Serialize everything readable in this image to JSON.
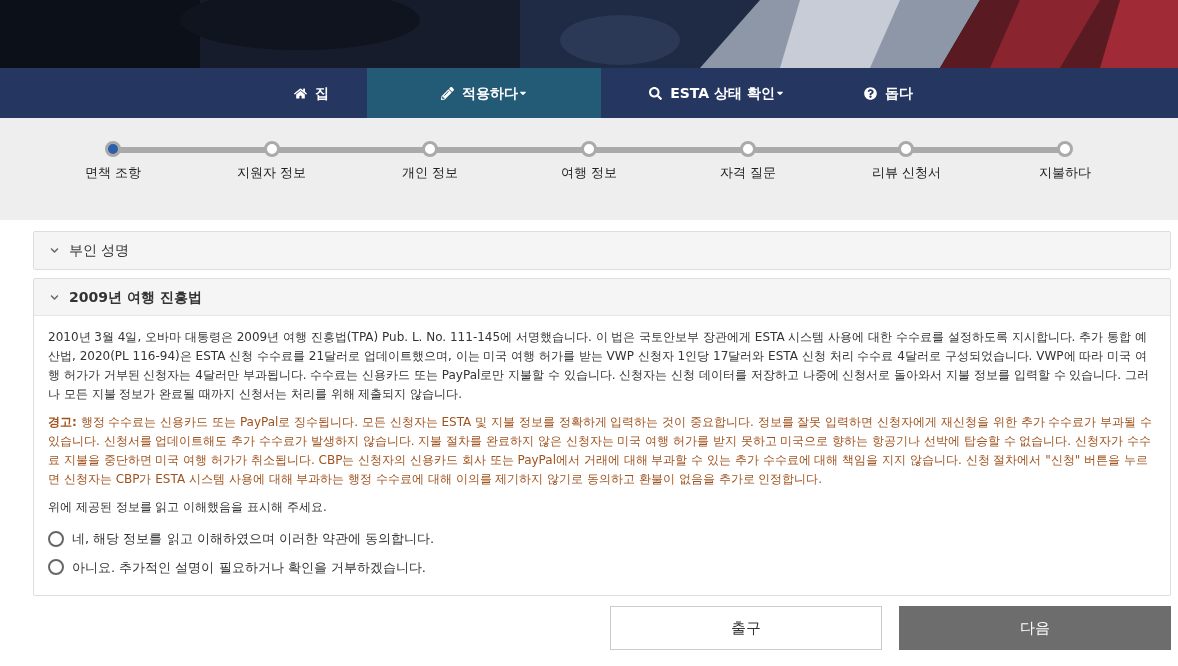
{
  "nav": [
    {
      "label": "집",
      "kind": "home",
      "selected": false,
      "dropdown": false
    },
    {
      "label": "적용하다",
      "kind": "pencil",
      "selected": true,
      "dropdown": true
    },
    {
      "label": "ESTA 상태 확인",
      "kind": "search",
      "selected": false,
      "dropdown": true
    },
    {
      "label": "돕다",
      "kind": "help",
      "selected": false,
      "dropdown": false
    }
  ],
  "steps": [
    {
      "label": "면책 조항",
      "selected": true
    },
    {
      "label": "지원자 정보",
      "selected": false
    },
    {
      "label": "개인 정보",
      "selected": false
    },
    {
      "label": "여행 정보",
      "selected": false
    },
    {
      "label": "자격 질문",
      "selected": false
    },
    {
      "label": "리뷰 신청서",
      "selected": false
    },
    {
      "label": "지불하다",
      "selected": false
    }
  ],
  "sections": [
    {
      "title": "부인 성명",
      "expanded": false
    },
    {
      "title": "2009년 여행 진흥법",
      "expanded": true,
      "paragraphs": [
        {
          "kind": "normal",
          "text": "2010년 3월 4일, 오바마 대통령은 2009년 여행 진흥법(TPA) Pub. L. No. 111-145에 서명했습니다. 이 법은 국토안보부 장관에게 ESTA 시스템 사용에 대한 수수료를 설정하도록 지시합니다. 추가 통합 예산법, 2020(PL 116-94)은 ESTA 신청 수수료를 21달러로 업데이트했으며, 이는 미국 여행 허가를 받는 VWP 신청자 1인당 17달러와 ESTA 신청 처리 수수료 4달러로 구성되었습니다. VWP에 따라 미국 여행 허가가 거부된 신청자는 4달러만 부과됩니다. 수수료는 신용카드 또는 PayPal로만 지불할 수 있습니다. 신청자는 신청 데이터를 저장하고 나중에 신청서로 돌아와서 지불 정보를 입력할 수 있습니다. 그러나 모든 지불 정보가 완료될 때까지 신청서는 처리를 위해 제출되지 않습니다."
        },
        {
          "kind": "warning",
          "text": "**경고:** 행정 수수료는 신용카드 또는 PayPal로 징수됩니다. 모든 신청자는 ESTA 및 지불 정보를 정확하게 입력하는 것이 중요합니다. 정보를 잘못 입력하면 신청자에게 재신청을 위한 추가 수수료가 부과될 수 있습니다. 신청서를 업데이트해도 추가 수수료가 발생하지 않습니다. 지불 절차를 완료하지 않은 신청자는 미국 여행 허가를 받지 못하고 미국으로 향하는 항공기나 선박에 탑승할 수 없습니다. 신청자가 수수료 지불을 중단하면 미국 여행 허가가 취소됩니다. CBP는 신청자의 신용카드 회사 또는 PayPal에서 거래에 대해 부과할 수 있는 추가 수수료에 대해 책임을 지지 않습니다. 신청 절차에서 \"신청\" 버튼을 누르면 신청자는 CBP가 ESTA 시스템 사용에 대해 부과하는 행정 수수료에 대해 이의를 제기하지 않기로 동의하고 환불이 없음을 추가로 인정합니다."
        },
        {
          "kind": "normal",
          "text": "위에 제공된 정보를 읽고 이해했음을 표시해 주세요."
        }
      ],
      "options": [
        {
          "label": "네, 해당 정보를 읽고 이해하였으며 이러한 약관에 동의합니다.",
          "checked": false
        },
        {
          "label": "아니요. 추가적인 설명이 필요하거나 확인을 거부하겠습니다.",
          "checked": false
        }
      ]
    }
  ],
  "buttons": [
    {
      "label": "출구",
      "kind": "secondary"
    },
    {
      "label": "다음",
      "kind": "primary"
    }
  ]
}
